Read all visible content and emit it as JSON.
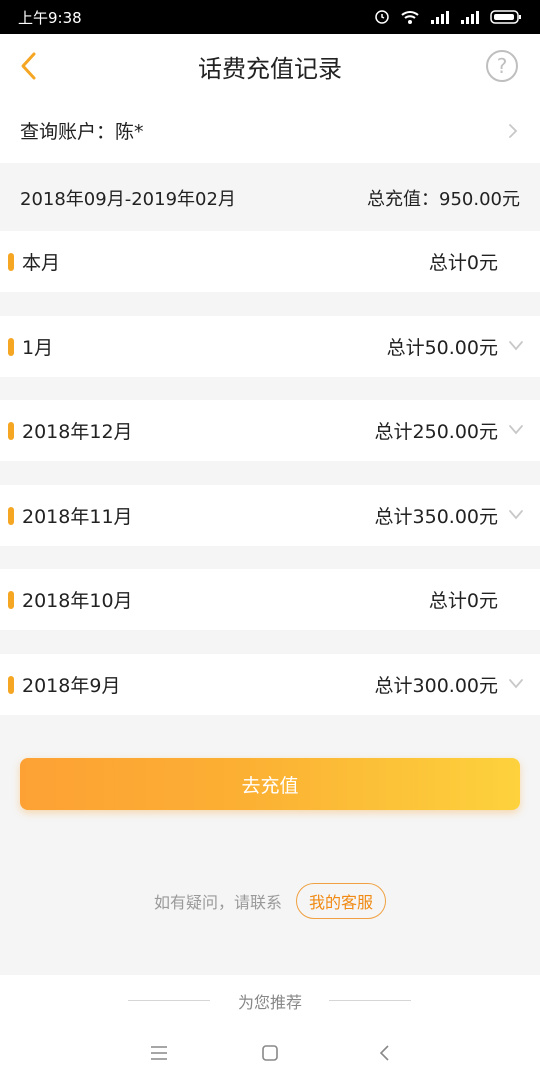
{
  "status_bar": {
    "time": "上午9:38"
  },
  "header": {
    "title": "话费充值记录",
    "help_symbol": "?"
  },
  "account": {
    "label": "查询账户：陈*"
  },
  "summary": {
    "period": "2018年09月-2019年02月",
    "total": "总充值：950.00元"
  },
  "months": [
    {
      "label": "本月",
      "total": "总计0元",
      "expandable": false
    },
    {
      "label": "1月",
      "total": "总计50.00元",
      "expandable": true
    },
    {
      "label": "2018年12月",
      "total": "总计250.00元",
      "expandable": true
    },
    {
      "label": "2018年11月",
      "total": "总计350.00元",
      "expandable": true
    },
    {
      "label": "2018年10月",
      "total": "总计0元",
      "expandable": false
    },
    {
      "label": "2018年9月",
      "total": "总计300.00元",
      "expandable": true
    }
  ],
  "recharge_button": {
    "label": "去充值"
  },
  "support": {
    "hint": "如有疑问，请联系",
    "button_label": "我的客服"
  },
  "recommend": {
    "label": "为您推荐"
  },
  "colors": {
    "accent": "#f5a623",
    "button_start": "#fda135",
    "button_end": "#fdd23d",
    "support_text": "#f08a14"
  }
}
